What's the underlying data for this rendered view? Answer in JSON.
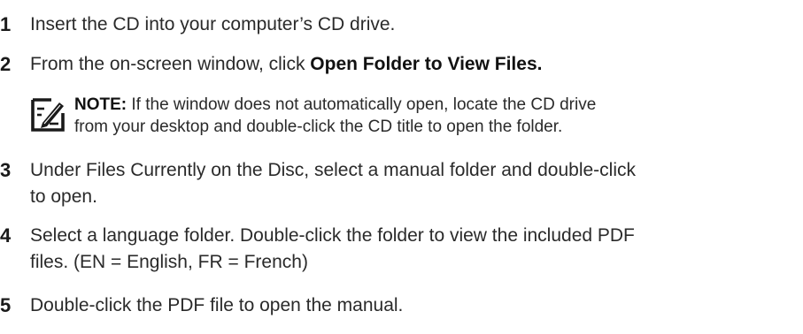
{
  "steps": [
    {
      "number": "1",
      "text": "Insert the CD into your computer’s CD drive."
    },
    {
      "number": "2",
      "text_prefix": "From the on-screen window, click ",
      "text_bold": "Open Folder to View Files."
    },
    {
      "number": "3",
      "line1": "Under Files Currently on the Disc, select a manual folder and double-click",
      "line2": "to open."
    },
    {
      "number": "4",
      "line1": "Select a language folder. Double-click the folder to view the included PDF",
      "line2": "files. (EN = English, FR = French)"
    },
    {
      "number": "5",
      "text": "Double-click the PDF file to open the manual."
    }
  ],
  "note": {
    "icon": "note-pencil-icon",
    "label": "NOTE:",
    "line1": " If the window does not automatically open, locate the CD drive",
    "line2": "from your desktop and double-click the CD title to open the folder."
  }
}
